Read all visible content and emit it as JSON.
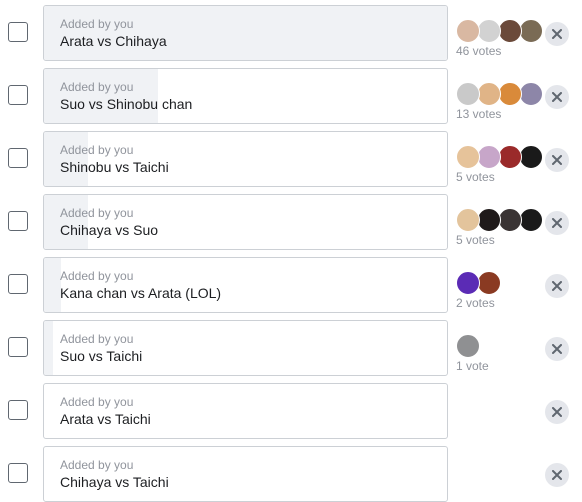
{
  "poll": {
    "options": [
      {
        "added_by": "Added by you",
        "text": "Arata vs Chihaya",
        "votes_label": "46 votes",
        "vote_fraction": 1.0,
        "voter_avatars": [
          {
            "color": "#d9b8a2"
          },
          {
            "color": "#d2d2d2"
          },
          {
            "color": "#6b4a3a"
          },
          {
            "color": "#7a6b55"
          }
        ]
      },
      {
        "added_by": "Added by you",
        "text": "Suo vs Shinobu chan",
        "votes_label": "13 votes",
        "vote_fraction": 0.283,
        "voter_avatars": [
          {
            "color": "#c9c9c9"
          },
          {
            "color": "#e0b487"
          },
          {
            "color": "#d98a3a"
          },
          {
            "color": "#8d86a8"
          }
        ]
      },
      {
        "added_by": "Added by you",
        "text": "Shinobu vs Taichi",
        "votes_label": "5 votes",
        "vote_fraction": 0.109,
        "voter_avatars": [
          {
            "color": "#e6c39a"
          },
          {
            "color": "#c7a6c9"
          },
          {
            "color": "#9a2a2a"
          },
          {
            "color": "#1a1a1a"
          }
        ]
      },
      {
        "added_by": "Added by you",
        "text": "Chihaya vs Suo",
        "votes_label": "5 votes",
        "vote_fraction": 0.109,
        "voter_avatars": [
          {
            "color": "#e3c49c"
          },
          {
            "color": "#1f1a1a"
          },
          {
            "color": "#3a3434"
          },
          {
            "color": "#1a1a1a"
          }
        ]
      },
      {
        "added_by": "Added by you",
        "text": "Kana chan vs Arata (LOL)",
        "votes_label": "2 votes",
        "vote_fraction": 0.043,
        "voter_avatars": [
          {
            "color": "#5b2bb5"
          },
          {
            "color": "#8a3a22"
          }
        ]
      },
      {
        "added_by": "Added by you",
        "text": "Suo vs Taichi",
        "votes_label": "1 vote",
        "vote_fraction": 0.022,
        "voter_avatars": [
          {
            "color": "#8f9092"
          }
        ]
      },
      {
        "added_by": "Added by you",
        "text": "Arata vs Taichi",
        "votes_label": "",
        "vote_fraction": 0.0,
        "voter_avatars": []
      },
      {
        "added_by": "Added by you",
        "text": "Chihaya vs Taichi",
        "votes_label": "",
        "vote_fraction": 0.0,
        "voter_avatars": []
      }
    ],
    "icons": {
      "remove": "close-icon"
    }
  }
}
